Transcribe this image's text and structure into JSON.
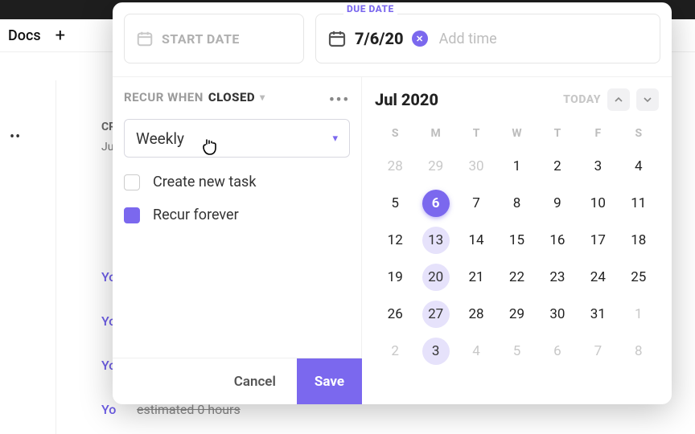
{
  "colors": {
    "accent": "#7b68ee"
  },
  "background": {
    "docs_label": "Docs",
    "cr_label": "CR",
    "ju_label": "Ju",
    "you_label": "Yo",
    "estimated_text": "estimated 0 hours"
  },
  "date_fields": {
    "start": {
      "placeholder": "START DATE"
    },
    "due": {
      "label": "DUE DATE",
      "value": "7/6/20",
      "add_time": "Add time"
    }
  },
  "recur": {
    "prefix": "RECUR WHEN",
    "state": "CLOSED",
    "frequency": "Weekly",
    "options": {
      "create_new_task": {
        "label": "Create new task",
        "checked": false
      },
      "recur_forever": {
        "label": "Recur forever",
        "checked": true
      }
    }
  },
  "calendar": {
    "month_title": "Jul 2020",
    "today_label": "TODAY",
    "dow": [
      "S",
      "M",
      "T",
      "W",
      "T",
      "F",
      "S"
    ],
    "weeks": [
      [
        {
          "d": "28",
          "muted": true,
          "shade": true
        },
        {
          "d": "29",
          "muted": true,
          "shade": true
        },
        {
          "d": "30",
          "muted": true,
          "shade": true
        },
        {
          "d": "1"
        },
        {
          "d": "2"
        },
        {
          "d": "3"
        },
        {
          "d": "4"
        }
      ],
      [
        {
          "d": "5"
        },
        {
          "d": "6",
          "selected": true
        },
        {
          "d": "7"
        },
        {
          "d": "8"
        },
        {
          "d": "9"
        },
        {
          "d": "10"
        },
        {
          "d": "11"
        }
      ],
      [
        {
          "d": "12"
        },
        {
          "d": "13",
          "ring": true
        },
        {
          "d": "14"
        },
        {
          "d": "15"
        },
        {
          "d": "16"
        },
        {
          "d": "17"
        },
        {
          "d": "18"
        }
      ],
      [
        {
          "d": "19"
        },
        {
          "d": "20",
          "ring": true
        },
        {
          "d": "21"
        },
        {
          "d": "22"
        },
        {
          "d": "23"
        },
        {
          "d": "24"
        },
        {
          "d": "25"
        }
      ],
      [
        {
          "d": "26"
        },
        {
          "d": "27",
          "ring": true
        },
        {
          "d": "28"
        },
        {
          "d": "29"
        },
        {
          "d": "30"
        },
        {
          "d": "31"
        },
        {
          "d": "1",
          "muted": true
        }
      ],
      [
        {
          "d": "2",
          "muted": true
        },
        {
          "d": "3",
          "muted": true,
          "ring": true
        },
        {
          "d": "4",
          "muted": true
        },
        {
          "d": "5",
          "muted": true
        },
        {
          "d": "6",
          "muted": true
        },
        {
          "d": "7",
          "muted": true
        },
        {
          "d": "8",
          "muted": true
        }
      ]
    ]
  },
  "footer": {
    "cancel": "Cancel",
    "save": "Save"
  }
}
